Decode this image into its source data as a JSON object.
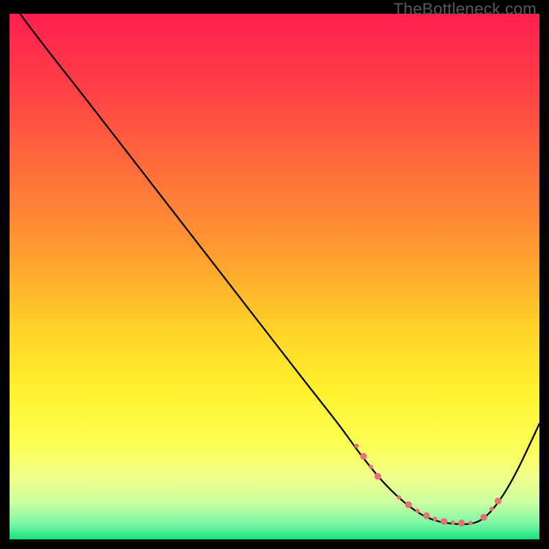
{
  "watermark": "TheBottleneck.com",
  "chart_data": {
    "type": "line",
    "title": "",
    "xlabel": "",
    "ylabel": "",
    "xlim": [
      0,
      100
    ],
    "ylim": [
      0,
      100
    ],
    "grid": false,
    "legend": false,
    "background_gradient": {
      "stops": [
        {
          "offset": 0.0,
          "color": "#ff1f4f"
        },
        {
          "offset": 0.15,
          "color": "#ff4245"
        },
        {
          "offset": 0.3,
          "color": "#ff6f3a"
        },
        {
          "offset": 0.45,
          "color": "#ff9a30"
        },
        {
          "offset": 0.6,
          "color": "#ffd328"
        },
        {
          "offset": 0.72,
          "color": "#fff22e"
        },
        {
          "offset": 0.82,
          "color": "#fdff55"
        },
        {
          "offset": 0.88,
          "color": "#f0ff8a"
        },
        {
          "offset": 0.93,
          "color": "#cdffa0"
        },
        {
          "offset": 0.97,
          "color": "#7cf7a5"
        },
        {
          "offset": 1.0,
          "color": "#18e27c"
        }
      ]
    },
    "series": [
      {
        "name": "curve",
        "color": "#000000",
        "x": [
          0,
          2,
          8,
          15,
          25,
          35,
          45,
          55,
          62,
          66,
          70,
          74,
          78,
          82,
          87,
          90,
          93,
          96,
          100
        ],
        "y": [
          104,
          100,
          92,
          83,
          70,
          57,
          44,
          31,
          22,
          16.5,
          11.5,
          7.5,
          4.6,
          3.2,
          3.0,
          4.5,
          8.2,
          13.5,
          22
        ]
      }
    ],
    "markers": {
      "name": "highlight-dots",
      "color": "#e57373",
      "radius_pattern": [
        3.2,
        5.0
      ],
      "points": [
        {
          "x": 65.5,
          "y": 17.8
        },
        {
          "x": 66.8,
          "y": 15.8
        },
        {
          "x": 68.2,
          "y": 13.8
        },
        {
          "x": 69.5,
          "y": 12.0
        },
        {
          "x": 73.5,
          "y": 8.0
        },
        {
          "x": 75.3,
          "y": 6.6
        },
        {
          "x": 77.0,
          "y": 5.4
        },
        {
          "x": 78.7,
          "y": 4.5
        },
        {
          "x": 80.3,
          "y": 3.9
        },
        {
          "x": 82.0,
          "y": 3.4
        },
        {
          "x": 83.7,
          "y": 3.2
        },
        {
          "x": 85.3,
          "y": 3.1
        },
        {
          "x": 87.0,
          "y": 3.1
        },
        {
          "x": 89.5,
          "y": 4.2
        },
        {
          "x": 91.0,
          "y": 5.8
        },
        {
          "x": 92.2,
          "y": 7.3
        }
      ]
    }
  }
}
